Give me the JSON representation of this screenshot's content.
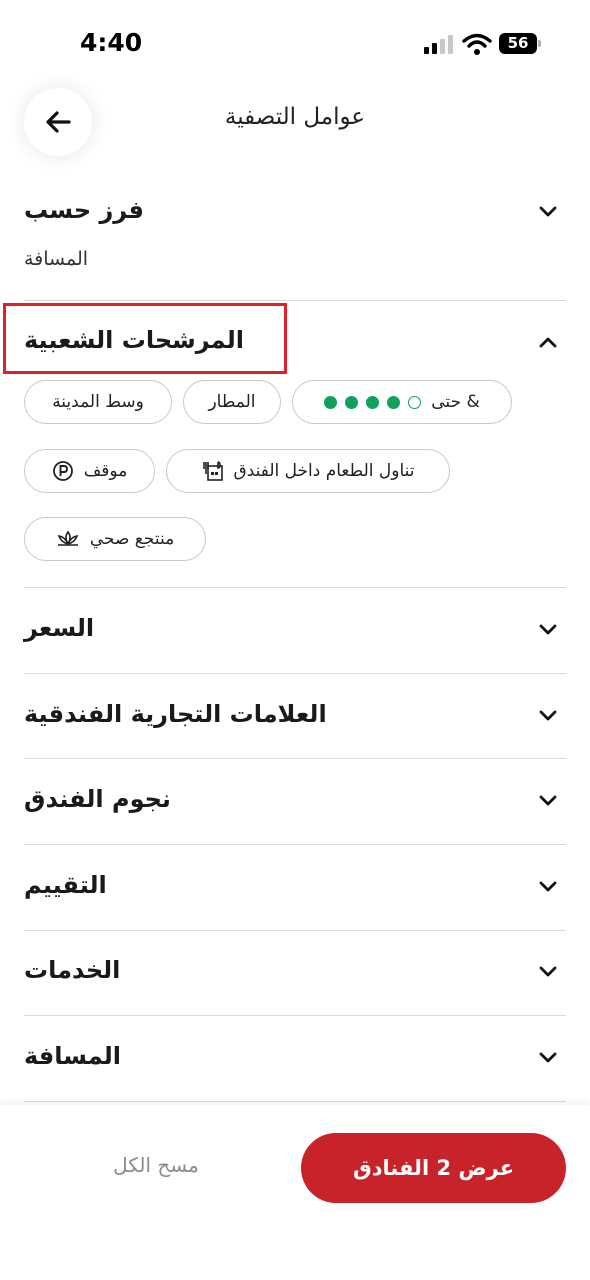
{
  "status": {
    "time": "4:40",
    "battery": "56"
  },
  "header": {
    "title": "عوامل التصفية"
  },
  "sort": {
    "title": "فرز حسب",
    "value": "المسافة"
  },
  "popular": {
    "title": "المرشحات الشعبية",
    "chips": {
      "rating": "& حتى",
      "airport": "المطار",
      "downtown": "وسط المدينة",
      "dining": "تناول الطعام داخل الفندق",
      "parking": "موقف",
      "spa": "منتجع صحي"
    },
    "rating_dots_filled": 4,
    "rating_dots_total": 5
  },
  "sections": {
    "price": "السعر",
    "brands": "العلامات التجارية الفندقية",
    "stars": "نجوم الفندق",
    "rating": "التقييم",
    "amenities": "الخدمات",
    "distance": "المسافة"
  },
  "footer": {
    "show_label": "عرض 2 الفنادق",
    "clear_label": "مسح الكل"
  },
  "colors": {
    "accent": "#c8232b",
    "rating_green": "#12a15b",
    "highlight": "#e0202a"
  },
  "icons": {
    "back": "arrow-left-icon",
    "expand": "chevron-down-icon",
    "collapse": "chevron-up-icon",
    "dining": "restaurant-icon",
    "parking": "parking-icon",
    "spa": "lotus-icon"
  }
}
